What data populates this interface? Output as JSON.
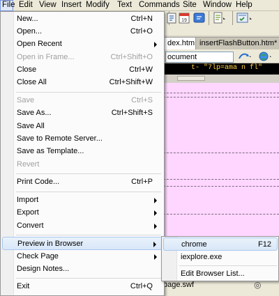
{
  "menubar": {
    "items": [
      {
        "label": "File",
        "active": true
      },
      {
        "label": "Edit"
      },
      {
        "label": "View"
      },
      {
        "label": "Insert"
      },
      {
        "label": "Modify"
      },
      {
        "label": "Text"
      },
      {
        "label": "Commands"
      },
      {
        "label": "Site"
      },
      {
        "label": "Window"
      },
      {
        "label": "Help"
      }
    ]
  },
  "toolbar": {
    "icons": [
      "code-view-icon",
      "calendar-icon",
      "chat-icon",
      "page-options-icon",
      "browser-check-icon"
    ]
  },
  "document": {
    "tabs": [
      {
        "label": "dex.htm",
        "active": true
      },
      {
        "label": "insertFlashButton.htm*",
        "active": false
      }
    ],
    "title_field": "ocument",
    "code_strip_text": "t- \"7lp=ama n fl\"",
    "status_file": "page.swf",
    "colors": {
      "design_view": "#ffd6ff",
      "code_strip": "#000000"
    }
  },
  "file_menu": {
    "items": [
      {
        "type": "item",
        "label": "New...",
        "shortcut": "Ctrl+N"
      },
      {
        "type": "item",
        "label": "Open...",
        "shortcut": "Ctrl+O"
      },
      {
        "type": "item",
        "label": "Open Recent",
        "submenu": true
      },
      {
        "type": "item",
        "label": "Open in Frame...",
        "shortcut": "Ctrl+Shift+O",
        "disabled": true
      },
      {
        "type": "item",
        "label": "Close",
        "shortcut": "Ctrl+W"
      },
      {
        "type": "item",
        "label": "Close All",
        "shortcut": "Ctrl+Shift+W"
      },
      {
        "type": "sep"
      },
      {
        "type": "item",
        "label": "Save",
        "shortcut": "Ctrl+S",
        "disabled": true
      },
      {
        "type": "item",
        "label": "Save As...",
        "shortcut": "Ctrl+Shift+S"
      },
      {
        "type": "item",
        "label": "Save All"
      },
      {
        "type": "item",
        "label": "Save to Remote Server..."
      },
      {
        "type": "item",
        "label": "Save as Template..."
      },
      {
        "type": "item",
        "label": "Revert",
        "disabled": true
      },
      {
        "type": "sep"
      },
      {
        "type": "item",
        "label": "Print Code...",
        "shortcut": "Ctrl+P"
      },
      {
        "type": "sep"
      },
      {
        "type": "item",
        "label": "Import",
        "submenu": true
      },
      {
        "type": "item",
        "label": "Export",
        "submenu": true
      },
      {
        "type": "item",
        "label": "Convert",
        "submenu": true
      },
      {
        "type": "sep"
      },
      {
        "type": "item",
        "label": "Preview in Browser",
        "submenu": true,
        "highlight": true
      },
      {
        "type": "item",
        "label": "Check Page",
        "submenu": true
      },
      {
        "type": "item",
        "label": "Design Notes..."
      },
      {
        "type": "sep"
      },
      {
        "type": "item",
        "label": "Exit",
        "shortcut": "Ctrl+Q"
      }
    ]
  },
  "preview_submenu": {
    "items": [
      {
        "type": "item",
        "label": "chrome",
        "shortcut": "F12",
        "highlight": true
      },
      {
        "type": "item",
        "label": "iexplore.exe"
      },
      {
        "type": "sep"
      },
      {
        "type": "item",
        "label": "Edit Browser List..."
      }
    ]
  }
}
